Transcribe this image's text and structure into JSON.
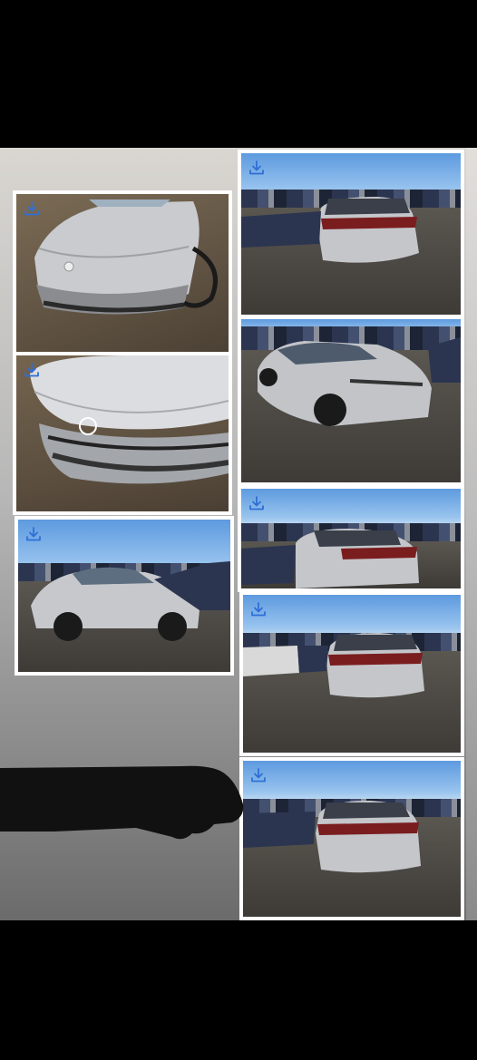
{
  "collage": {
    "photos": [
      {
        "name": "front-damage-closeup",
        "icon": "download-icon"
      },
      {
        "name": "front-bumper-closeup",
        "icon": "download-icon"
      },
      {
        "name": "side-front-lot",
        "icon": "download-icon"
      },
      {
        "name": "rear-view-1",
        "icon": "download-icon"
      },
      {
        "name": "side-front-right",
        "icon": "download-icon"
      },
      {
        "name": "rear-quarter",
        "icon": "download-icon"
      },
      {
        "name": "rear-view-2",
        "icon": "download-icon"
      },
      {
        "name": "rear-view-3",
        "icon": "download-icon"
      }
    ]
  },
  "colors": {
    "background": "#000000",
    "frame": "#ffffff",
    "icon": "#2f6fd6",
    "car_body": "#c2c4c8",
    "taillight": "#7a1d1f"
  }
}
